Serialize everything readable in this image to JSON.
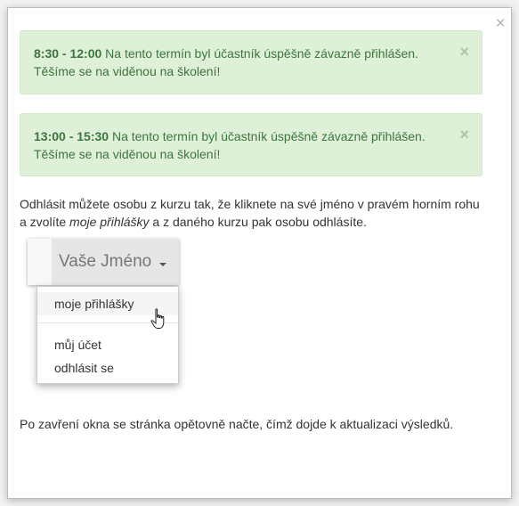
{
  "modal": {
    "close_glyph": "×"
  },
  "alerts": [
    {
      "time": "8:30 - 12:00",
      "message": "Na tento termín byl účastník úspěšně závazně přihlášen.",
      "message2": "Těšíme se na viděnou na školení!",
      "close_glyph": "×"
    },
    {
      "time": "13:00 - 15:30",
      "message": "Na tento termín byl účastník úspěšně závazně přihlášen.",
      "message2": "Těšíme se na viděnou na školení!",
      "close_glyph": "×"
    }
  ],
  "instructions": {
    "line1": "Odhlásit můžete osobu z kurzu tak, že kliknete na své jméno v pravém horním rohu",
    "line2_prefix": "a zvolíte ",
    "line2_emphasis": "moje přihlášky",
    "line2_suffix": " a z daného kurzu pak osobu odhlásíte."
  },
  "illustration": {
    "user_name": "Vaše Jméno",
    "menu_items": [
      "moje přihlášky",
      "můj účet",
      "odhlásit se"
    ],
    "cursor_icon": "hand-pointer-icon"
  },
  "footer": {
    "text": "Po zavření okna se stránka opětovně načte, čímž dojde k aktualizaci výsledků."
  },
  "colors": {
    "alert_bg": "#dff0d8",
    "alert_text": "#3c763d",
    "body_text": "#333333"
  }
}
